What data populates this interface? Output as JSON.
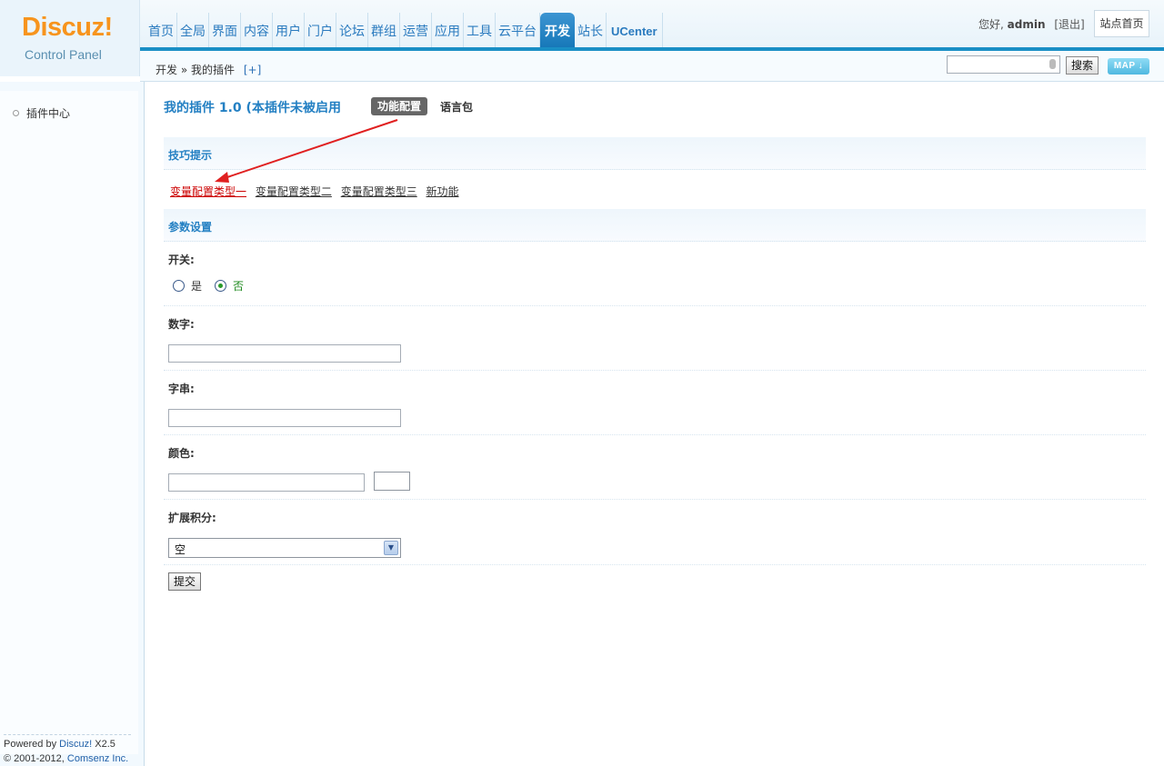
{
  "logo": {
    "brand": "Discuz!",
    "subtitle": "Control Panel"
  },
  "nav": [
    {
      "label": "首页"
    },
    {
      "label": "全局"
    },
    {
      "label": "界面"
    },
    {
      "label": "内容"
    },
    {
      "label": "用户"
    },
    {
      "label": "门户"
    },
    {
      "label": "论坛"
    },
    {
      "label": "群组"
    },
    {
      "label": "运营"
    },
    {
      "label": "应用"
    },
    {
      "label": "工具"
    },
    {
      "label": "云平台"
    },
    {
      "label": "开发",
      "active": true
    },
    {
      "label": "站长"
    },
    {
      "label": "UCenter"
    }
  ],
  "user": {
    "greeting": "您好,",
    "name": "admin",
    "logout": "[退出]",
    "site_home": "站点首页"
  },
  "breadcrumb": {
    "root": "开发",
    "sep": "»",
    "current": "我的插件",
    "add": "[+]"
  },
  "search": {
    "button": "搜索",
    "map": "MAP ↓"
  },
  "sidebar": {
    "items": [
      {
        "label": "插件中心"
      }
    ]
  },
  "footer": {
    "powered": "Powered by",
    "brand": "Discuz!",
    "version": "X2.5",
    "copyright": "© 2001-2012,",
    "company": "Comsenz Inc."
  },
  "main": {
    "title": "我的插件 1.0 (本插件未被启用",
    "tab_active": "功能配置",
    "tab_lang": "语言包",
    "tips_header": "技巧提示",
    "tips": [
      {
        "label": "变量配置类型一",
        "active": true
      },
      {
        "label": "变量配置类型二"
      },
      {
        "label": "变量配置类型三"
      },
      {
        "label": "新功能"
      }
    ],
    "params_header": "参数设置",
    "switch_label": "开关:",
    "switch_yes": "是",
    "switch_no": "否",
    "number_label": "数字:",
    "string_label": "字串:",
    "color_label": "颜色:",
    "credit_label": "扩展积分:",
    "credit_value": "空",
    "submit": "提交"
  },
  "colors": {
    "accent": "#1a8fc5",
    "title": "#2480c3",
    "active_tip": "#cc0000",
    "arrow": "#e02020"
  }
}
